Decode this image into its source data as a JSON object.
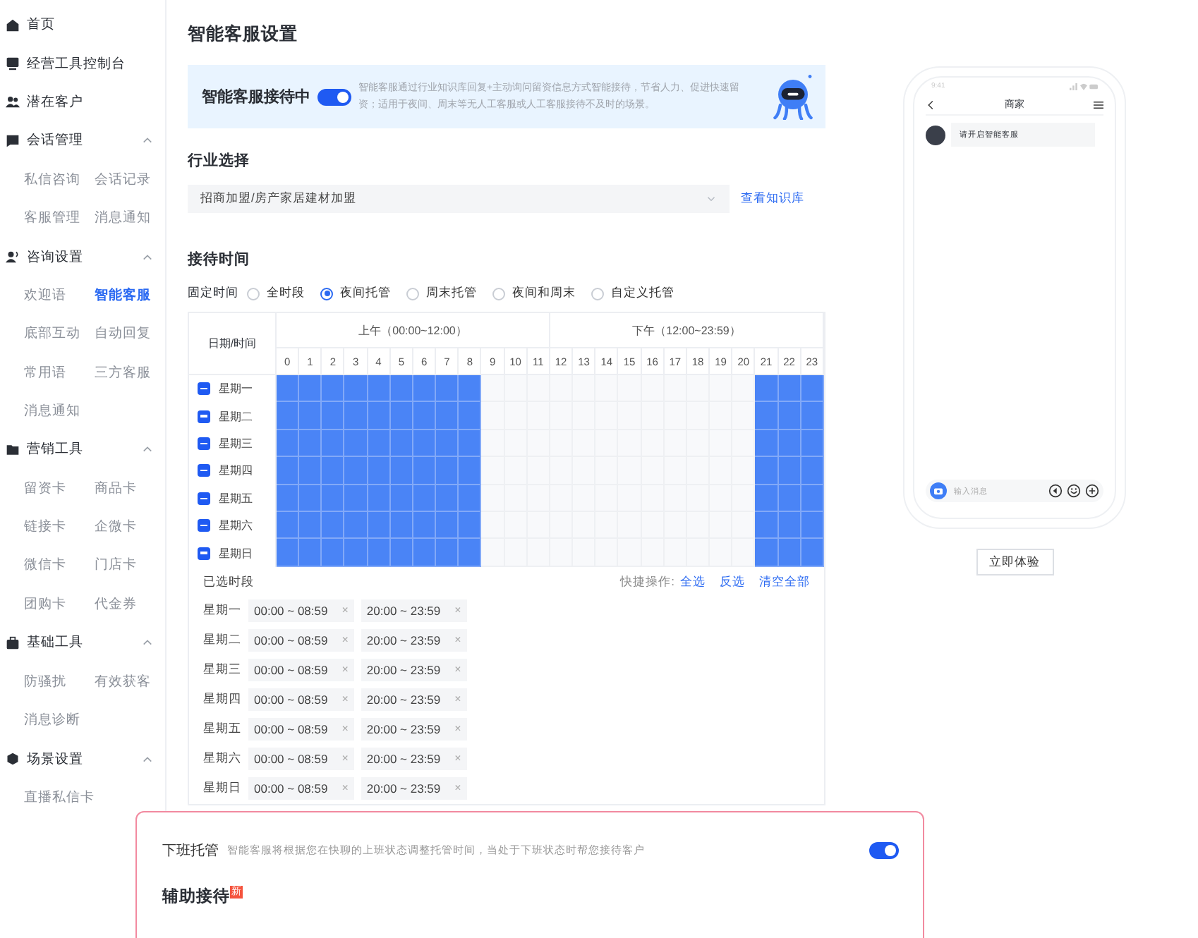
{
  "sidebar": {
    "items": [
      {
        "kind": "link",
        "label": "首页"
      },
      {
        "kind": "link",
        "label": "经营工具控制台"
      },
      {
        "kind": "link",
        "label": "潜在客户"
      },
      {
        "kind": "group",
        "label": "会话管理",
        "expanded": true,
        "children": [
          {
            "label": "私信咨询",
            "selected": false
          },
          {
            "label": "会话记录",
            "selected": false
          },
          {
            "label": "客服管理",
            "selected": false
          },
          {
            "label": "消息通知",
            "selected": false
          }
        ]
      },
      {
        "kind": "group",
        "label": "咨询设置",
        "expanded": true,
        "children": [
          {
            "label": "欢迎语",
            "selected": false
          },
          {
            "label": "智能客服",
            "selected": true
          },
          {
            "label": "底部互动",
            "selected": false
          },
          {
            "label": "自动回复",
            "selected": false
          },
          {
            "label": "常用语",
            "selected": false
          },
          {
            "label": "三方客服",
            "selected": false
          },
          {
            "label": "消息通知",
            "selected": false
          }
        ]
      },
      {
        "kind": "group",
        "label": "营销工具",
        "expanded": true,
        "children": [
          {
            "label": "留资卡",
            "selected": false
          },
          {
            "label": "商品卡",
            "selected": false
          },
          {
            "label": "链接卡",
            "selected": false
          },
          {
            "label": "企微卡",
            "selected": false
          },
          {
            "label": "微信卡",
            "selected": false
          },
          {
            "label": "门店卡",
            "selected": false
          },
          {
            "label": "团购卡",
            "selected": false
          },
          {
            "label": "代金券",
            "selected": false
          }
        ]
      },
      {
        "kind": "group",
        "label": "基础工具",
        "expanded": true,
        "children": [
          {
            "label": "防骚扰",
            "selected": false
          },
          {
            "label": "有效获客",
            "selected": false
          },
          {
            "label": "消息诊断",
            "selected": false
          }
        ]
      },
      {
        "kind": "group",
        "label": "场景设置",
        "expanded": true,
        "children": [
          {
            "label": "直播私信卡",
            "selected": false
          }
        ]
      }
    ]
  },
  "page_title": "智能客服设置",
  "banner": {
    "label": "智能客服接待中",
    "on": true,
    "description": "智能客服通过行业知识库回复+主动询问留资信息方式智能接待，节省人力、促进快速留资；适用于夜间、周末等无人工客服或人工客服接待不及时的场景。"
  },
  "industry": {
    "heading": "行业选择",
    "value": "招商加盟/房产家居建材加盟",
    "link": "查看知识库"
  },
  "schedule": {
    "heading": "接待时间",
    "mode_label": "固定时间",
    "modes": [
      {
        "label": "全时段",
        "selected": false
      },
      {
        "label": "夜间托管",
        "selected": true
      },
      {
        "label": "周末托管",
        "selected": false
      },
      {
        "label": "夜间和周末",
        "selected": false
      },
      {
        "label": "自定义托管",
        "selected": false
      }
    ],
    "corner": "日期/时间",
    "periods": [
      "上午（00:00~12:00）",
      "下午（12:00~23:59）"
    ],
    "hours": [
      "0",
      "1",
      "2",
      "3",
      "4",
      "5",
      "6",
      "7",
      "8",
      "9",
      "10",
      "11",
      "12",
      "13",
      "14",
      "15",
      "16",
      "17",
      "18",
      "19",
      "20",
      "21",
      "22",
      "23"
    ],
    "days": [
      {
        "label": "星期一",
        "checked": true,
        "cells": [
          true,
          true,
          true,
          true,
          true,
          true,
          true,
          true,
          true,
          false,
          false,
          false,
          false,
          false,
          false,
          false,
          false,
          false,
          false,
          false,
          false,
          true,
          true,
          true
        ]
      },
      {
        "label": "星期二",
        "checked": true,
        "cells": [
          true,
          true,
          true,
          true,
          true,
          true,
          true,
          true,
          true,
          false,
          false,
          false,
          false,
          false,
          false,
          false,
          false,
          false,
          false,
          false,
          false,
          true,
          true,
          true
        ]
      },
      {
        "label": "星期三",
        "checked": true,
        "cells": [
          true,
          true,
          true,
          true,
          true,
          true,
          true,
          true,
          true,
          false,
          false,
          false,
          false,
          false,
          false,
          false,
          false,
          false,
          false,
          false,
          false,
          true,
          true,
          true
        ]
      },
      {
        "label": "星期四",
        "checked": true,
        "cells": [
          true,
          true,
          true,
          true,
          true,
          true,
          true,
          true,
          true,
          false,
          false,
          false,
          false,
          false,
          false,
          false,
          false,
          false,
          false,
          false,
          false,
          true,
          true,
          true
        ]
      },
      {
        "label": "星期五",
        "checked": true,
        "cells": [
          true,
          true,
          true,
          true,
          true,
          true,
          true,
          true,
          true,
          false,
          false,
          false,
          false,
          false,
          false,
          false,
          false,
          false,
          false,
          false,
          false,
          true,
          true,
          true
        ]
      },
      {
        "label": "星期六",
        "checked": true,
        "cells": [
          true,
          true,
          true,
          true,
          true,
          true,
          true,
          true,
          true,
          false,
          false,
          false,
          false,
          false,
          false,
          false,
          false,
          false,
          false,
          false,
          false,
          true,
          true,
          true
        ]
      },
      {
        "label": "星期日",
        "checked": true,
        "cells": [
          true,
          true,
          true,
          true,
          true,
          true,
          true,
          true,
          true,
          false,
          false,
          false,
          false,
          false,
          false,
          false,
          false,
          false,
          false,
          false,
          false,
          true,
          true,
          true
        ]
      }
    ],
    "selected_heading": "已选时段",
    "shortcut_label": "快捷操作:",
    "shortcuts": [
      "全选",
      "反选",
      "清空全部"
    ],
    "selected_rows": [
      {
        "day": "星期一",
        "ranges": [
          {
            "text": "00:00 ~ 08:59",
            "close": "×"
          },
          {
            "text": "20:00 ~ 23:59",
            "close": "×"
          }
        ]
      },
      {
        "day": "星期二",
        "ranges": [
          {
            "text": "00:00 ~ 08:59",
            "close": "×"
          },
          {
            "text": "20:00 ~ 23:59",
            "close": "×"
          }
        ]
      },
      {
        "day": "星期三",
        "ranges": [
          {
            "text": "00:00 ~ 08:59",
            "close": "×"
          },
          {
            "text": "20:00 ~ 23:59",
            "close": "×"
          }
        ]
      },
      {
        "day": "星期四",
        "ranges": [
          {
            "text": "00:00 ~ 08:59",
            "close": "×"
          },
          {
            "text": "20:00 ~ 23:59",
            "close": "×"
          }
        ]
      },
      {
        "day": "星期五",
        "ranges": [
          {
            "text": "00:00 ~ 08:59",
            "close": "×"
          },
          {
            "text": "20:00 ~ 23:59",
            "close": "×"
          }
        ]
      },
      {
        "day": "星期六",
        "ranges": [
          {
            "text": "00:00 ~ 08:59",
            "close": "×"
          },
          {
            "text": "20:00 ~ 23:59",
            "close": "×"
          }
        ]
      },
      {
        "day": "星期日",
        "ranges": [
          {
            "text": "00:00 ~ 08:59",
            "close": "×"
          },
          {
            "text": "20:00 ~ 23:59",
            "close": "×"
          }
        ]
      }
    ]
  },
  "preview": {
    "time": "9:41",
    "title": "商家",
    "message": "请开启智能客服",
    "input_placeholder": "输入消息",
    "button": "立即体验"
  },
  "overlay": {
    "offwork": {
      "title": "下班托管",
      "description": "智能客服将根据您在快聊的上班状态调整托管时间，当处于下班状态时帮您接待客户",
      "on": true
    },
    "assist": {
      "title": "辅助接待",
      "badge": "新"
    }
  }
}
